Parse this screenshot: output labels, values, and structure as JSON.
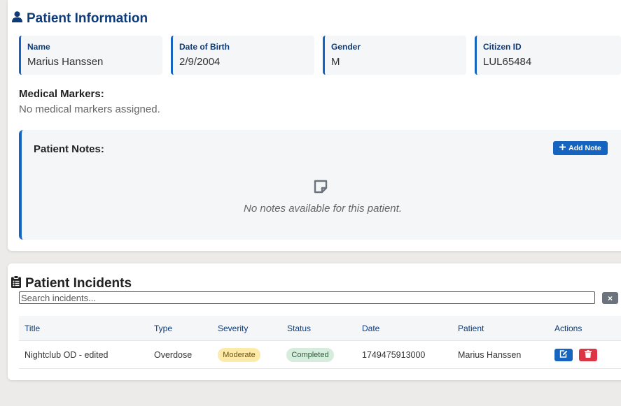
{
  "patient_info": {
    "title": "Patient Information",
    "fields": [
      {
        "label": "Name",
        "value": "Marius Hanssen"
      },
      {
        "label": "Date of Birth",
        "value": "2/9/2004"
      },
      {
        "label": "Gender",
        "value": "M"
      },
      {
        "label": "Citizen ID",
        "value": "LUL65484"
      }
    ],
    "markers_label": "Medical Markers:",
    "markers_empty": "No medical markers assigned.",
    "notes": {
      "title": "Patient Notes:",
      "add_button": "Add Note",
      "empty": "No notes available for this patient."
    }
  },
  "incidents": {
    "title": "Patient Incidents",
    "search_placeholder": "Search incidents...",
    "clear_label": "×",
    "columns": [
      "Title",
      "Type",
      "Severity",
      "Status",
      "Date",
      "Patient",
      "Actions"
    ],
    "rows": [
      {
        "title": "Nightclub OD - edited",
        "type": "Overdose",
        "severity": "Moderate",
        "status": "Completed",
        "date": "1749475913000",
        "patient": "Marius Hanssen"
      }
    ]
  },
  "colors": {
    "primary": "#1565c0",
    "heading": "#0d3b7a",
    "danger": "#dc3545",
    "severity_moderate_bg": "#fde9a8",
    "status_completed_bg": "#d6ecdd"
  },
  "icons": {
    "info_title": "user-icon",
    "incidents_title": "clipboard-list-icon",
    "add_note": "plus-icon",
    "notes_empty": "sticky-note-icon",
    "edit": "edit-icon",
    "delete": "trash-icon",
    "clear": "close-icon"
  }
}
